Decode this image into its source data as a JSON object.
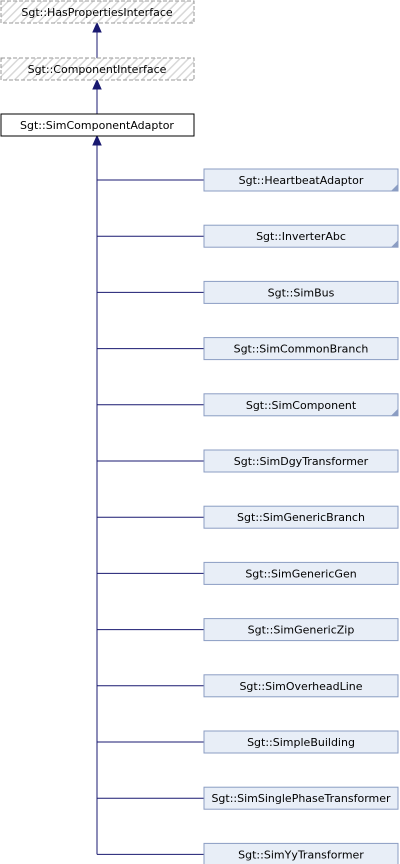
{
  "diagram": {
    "title": "",
    "interfaces": [
      {
        "id": "has-properties-interface",
        "label": "Sgt::HasPropertiesInterface"
      },
      {
        "id": "component-interface",
        "label": "Sgt::ComponentInterface"
      }
    ],
    "base": {
      "id": "sim-component-adaptor",
      "label": "Sgt::SimComponentAdaptor"
    },
    "children": [
      {
        "label": "Sgt::HeartbeatAdaptor",
        "has_more": true
      },
      {
        "label": "Sgt::InverterAbc",
        "has_more": true
      },
      {
        "label": "Sgt::SimBus",
        "has_more": false
      },
      {
        "label": "Sgt::SimCommonBranch",
        "has_more": false
      },
      {
        "label": "Sgt::SimComponent",
        "has_more": true
      },
      {
        "label": "Sgt::SimDgyTransformer",
        "has_more": false
      },
      {
        "label": "Sgt::SimGenericBranch",
        "has_more": false
      },
      {
        "label": "Sgt::SimGenericGen",
        "has_more": false
      },
      {
        "label": "Sgt::SimGenericZip",
        "has_more": false
      },
      {
        "label": "Sgt::SimOverheadLine",
        "has_more": false
      },
      {
        "label": "Sgt::SimpleBuilding",
        "has_more": false
      },
      {
        "label": "Sgt::SimSinglePhaseTransformer",
        "has_more": false
      },
      {
        "label": "Sgt::SimYyTransformer",
        "has_more": false
      }
    ],
    "colors": {
      "edge": "#191970",
      "child_fill": "#e8eef7",
      "child_border": "#8b9dc3",
      "interface_border": "#9a9a9a",
      "interface_hatch": "#d8d8d8",
      "base_border": "#000000"
    }
  }
}
